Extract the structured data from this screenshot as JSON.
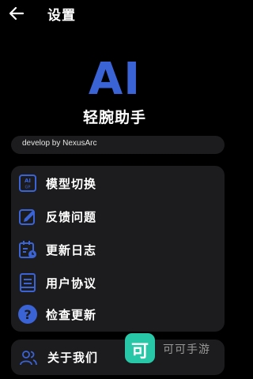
{
  "header": {
    "title": "设置",
    "back_icon": "arrow-left-icon"
  },
  "branding": {
    "logo_text": "AI",
    "logo_color": "#3a63d6",
    "app_name": "轻腕助手"
  },
  "developer": {
    "text": "develop by NexusArc"
  },
  "menu": {
    "items": [
      {
        "label": "模型切换",
        "icon": "ai-chip-icon"
      },
      {
        "label": "反馈问题",
        "icon": "feedback-edit-icon"
      },
      {
        "label": "更新日志",
        "icon": "calendar-log-icon"
      },
      {
        "label": "用户协议",
        "icon": "agreement-document-icon"
      },
      {
        "label": "检查更新",
        "icon": "help-question-icon"
      }
    ],
    "accent": "#3a63d6"
  },
  "about": {
    "label": "关于我们",
    "icon": "users-icon"
  },
  "watermark": {
    "glyph": "可",
    "text": "可可手游",
    "color": "#27c7a8"
  }
}
